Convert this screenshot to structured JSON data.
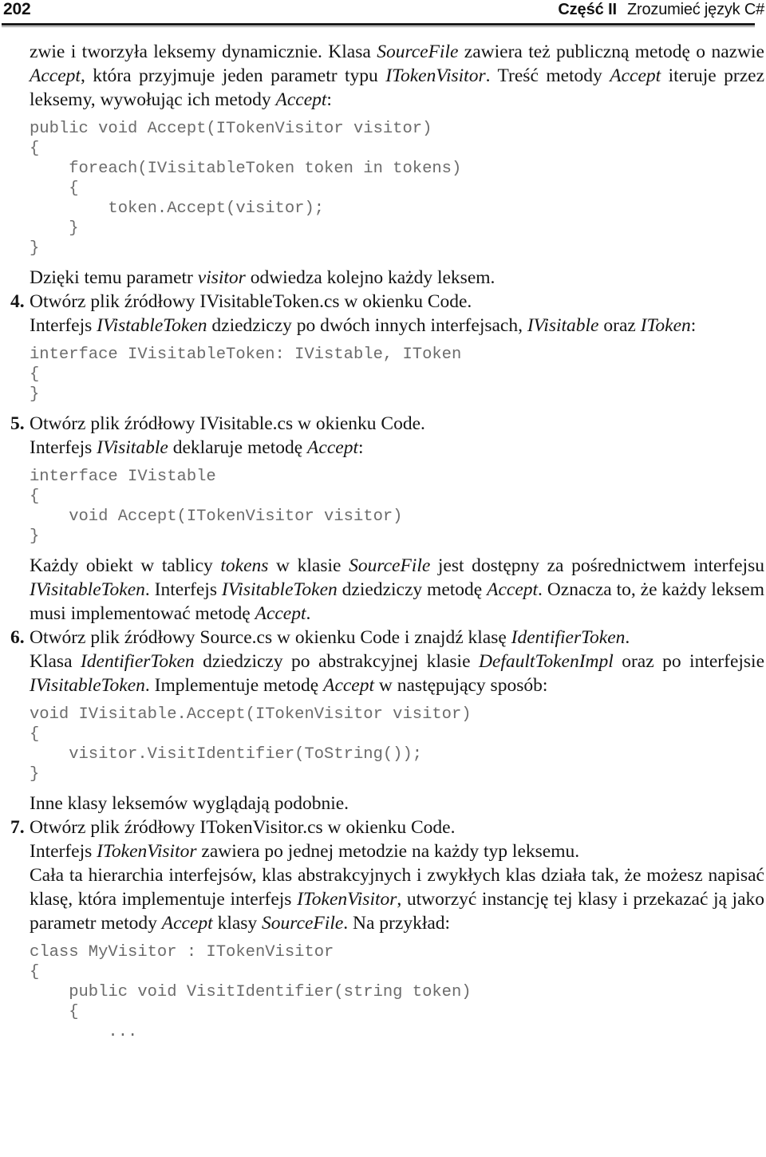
{
  "header": {
    "page_number": "202",
    "part": "Część II",
    "book_title": "Zrozumieć język C#"
  },
  "content": {
    "para_intro_line1": "zwie i tworzyła leksemy dynamicznie. Klasa ",
    "para_intro_em1": "SourceFile",
    "para_intro_line2": " zawiera też publiczną metodę o nazwie ",
    "para_intro_em2": "Accept",
    "para_intro_line3": ", która przyjmuje jeden parametr typu ",
    "para_intro_em3": "ITokenVisitor",
    "para_intro_line4": ". Treść metody ",
    "para_intro_em4": "Accept",
    "para_intro_line5": " iteruje przez leksemy, wywołując ich metody ",
    "para_intro_em5": "Accept",
    "para_intro_line6": ":",
    "code_accept": "public void Accept(ITokenVisitor visitor)\n{\n    foreach(IVisitableToken token in tokens)\n    {\n        token.Accept(visitor);\n    }\n}",
    "para_visitor_pre": "Dzięki temu parametr ",
    "para_visitor_em": "visitor",
    "para_visitor_post": " odwiedza kolejno każdy leksem.",
    "step4_number": "4.",
    "step4_text": "Otwórz plik źródłowy IVisitableToken.cs w okienku Code.",
    "para_ivistable_pre": "Interfejs ",
    "para_ivistable_em1": "IVistableToken",
    "para_ivistable_mid": " dziedziczy po dwóch innych interfejsach, ",
    "para_ivistable_em2": "IVisitable",
    "para_ivistable_mid2": " oraz ",
    "para_ivistable_em3": "IToken",
    "para_ivistable_post": ":",
    "code_ivisitabletoken": "interface IVisitableToken: IVistable, IToken\n{\n}",
    "step5_number": "5.",
    "step5_text": "Otwórz plik źródłowy IVisitable.cs w okienku Code.",
    "para_declares_pre": "Interfejs ",
    "para_declares_em1": "IVisitable",
    "para_declares_mid": " deklaruje metodę ",
    "para_declares_em2": "Accept",
    "para_declares_post": ":",
    "code_ivistable": "interface IVistable\n{\n    void Accept(ITokenVisitor visitor)\n}",
    "para_each_pre": "Każdy obiekt w tablicy ",
    "para_each_em1": "tokens",
    "para_each_mid1": " w klasie ",
    "para_each_em2": "SourceFile",
    "para_each_mid2": " jest dostępny za pośrednictwem interfejsu ",
    "para_each_em3": "IVisitableToken",
    "para_each_mid3": ". Interfejs ",
    "para_each_em4": "IVisitableToken",
    "para_each_mid4": " dziedziczy metodę ",
    "para_each_em5": "Accept",
    "para_each_mid5": ". Oznacza to, że każdy leksem musi implementować metodę ",
    "para_each_em6": "Accept",
    "para_each_post": ".",
    "step6_number": "6.",
    "step6_text_pre": "Otwórz plik źródłowy Source.cs w okienku Code i znajdź klasę ",
    "step6_em": "IdentifierToken",
    "step6_text_post": ".",
    "para_klasa_pre": "Klasa ",
    "para_klasa_em1": "IdentifierToken",
    "para_klasa_mid1": " dziedziczy po abstrakcyjnej klasie ",
    "para_klasa_em2": "DefaultTokenImpl",
    "para_klasa_mid2": " oraz po interfejsie ",
    "para_klasa_em3": "IVisitableToken",
    "para_klasa_mid3": ". Implementuje metodę ",
    "para_klasa_em4": "Accept",
    "para_klasa_post": " w następujący sposób:",
    "code_visitidentifier": "void IVisitable.Accept(ITokenVisitor visitor)\n{\n    visitor.VisitIdentifier(ToString());\n}",
    "para_inne": "Inne klasy leksemów wyglądają podobnie.",
    "step7_number": "7.",
    "step7_text": "Otwórz plik źródłowy ITokenVisitor.cs w okienku Code.",
    "para_zawiera_pre": "Interfejs ",
    "para_zawiera_em": "ITokenVisitor",
    "para_zawiera_post": " zawiera po jednej metodzie na każdy typ leksemu.",
    "para_cala_pre": "Cała ta hierarchia interfejsów, klas abstrakcyjnych i zwykłych klas działa tak, że możesz napisać klasę, która implementuje interfejs ",
    "para_cala_em1": "ITokenVisitor",
    "para_cala_mid1": ", utworzyć instancję tej klasy i przekazać ją jako parametr metody ",
    "para_cala_em2": "Accept",
    "para_cala_mid2": " klasy ",
    "para_cala_em3": "SourceFile",
    "para_cala_post": ". Na przykład:",
    "code_myvisitor": "class MyVisitor : ITokenVisitor\n{\n    public void VisitIdentifier(string token)\n    {\n        ..."
  }
}
